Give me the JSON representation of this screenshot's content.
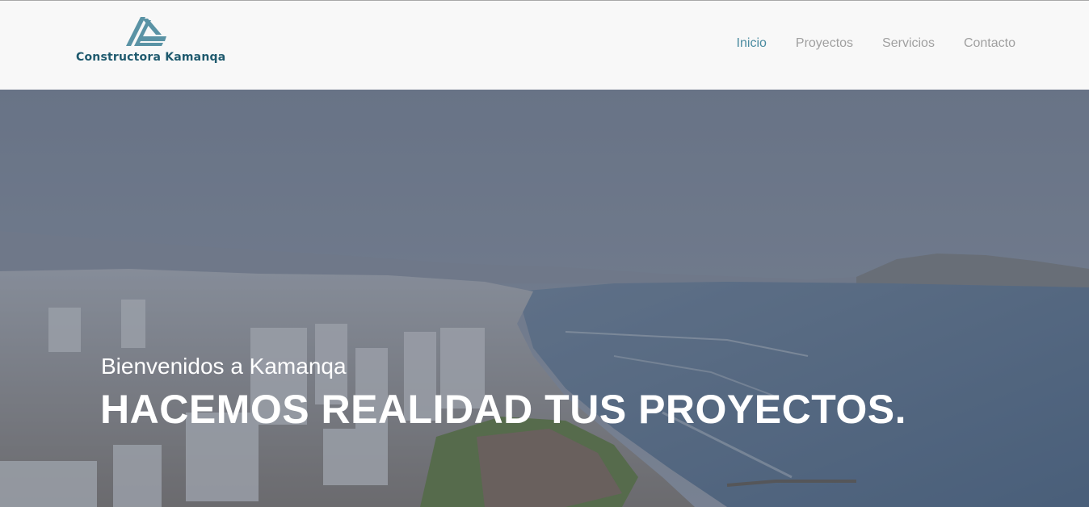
{
  "brand": {
    "name": "Constructora Kamanqa",
    "logo_icon": "kamanqa-stripes-icon"
  },
  "nav": {
    "items": [
      {
        "label": "Inicio",
        "active": true
      },
      {
        "label": "Proyectos"
      },
      {
        "label": "Servicios"
      },
      {
        "label": "Contacto"
      }
    ]
  },
  "hero": {
    "subtitle": "Bienvenidos a Kamanqa",
    "title": "HACEMOS REALIDAD TUS PROYECTOS.",
    "background": "coastal-city-aerial-photo"
  },
  "colors": {
    "brand": "#1f5a6e",
    "logo_accent": "#5a93a5",
    "nav_active": "#4a8ba0",
    "nav_inactive": "#a0a0a0",
    "header_bg": "#f8f8f8"
  }
}
